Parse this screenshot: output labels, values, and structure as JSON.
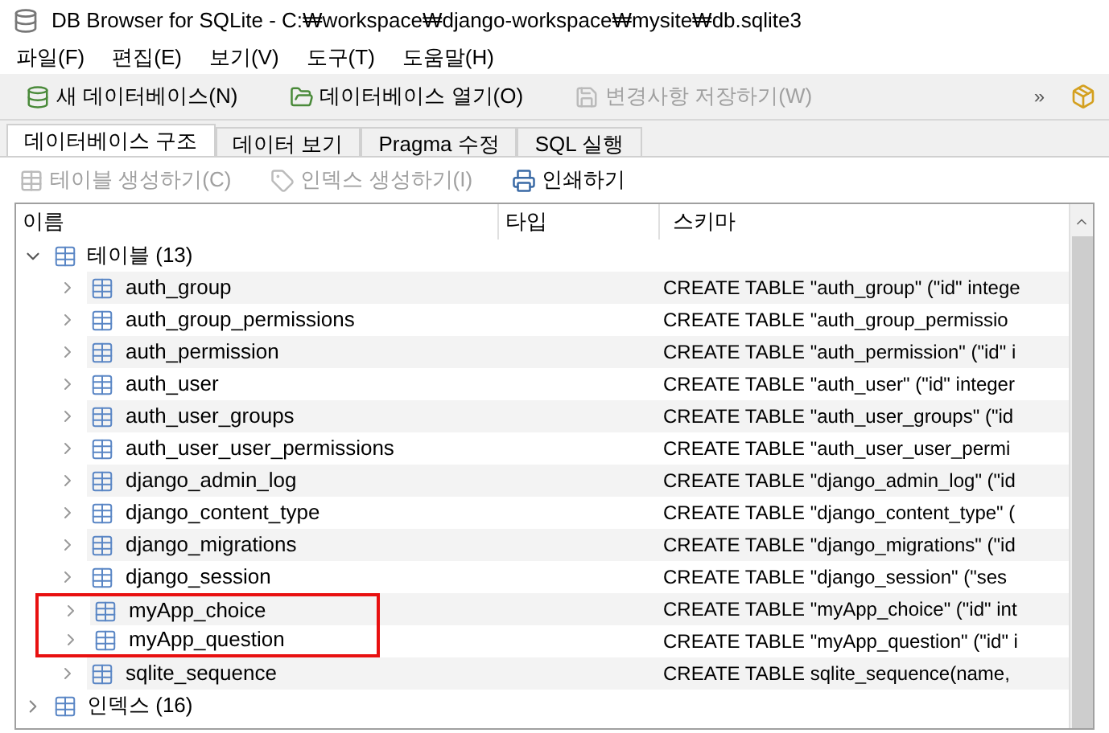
{
  "window": {
    "title": "DB Browser for SQLite - C:₩workspace₩django-workspace₩mysite₩db.sqlite3"
  },
  "menu": [
    "파일(F)",
    "편집(E)",
    "보기(V)",
    "도구(T)",
    "도움말(H)"
  ],
  "toolbar": [
    {
      "label": "새 데이터베이스(N)",
      "disabled": false,
      "kind": "new"
    },
    {
      "label": "데이터베이스 열기(O)",
      "disabled": false,
      "kind": "open"
    },
    {
      "label": "변경사항 저장하기(W)",
      "disabled": true,
      "kind": "save"
    }
  ],
  "toolbar_overflow": "»",
  "tabs": [
    {
      "label": "데이터베이스 구조",
      "selected": true
    },
    {
      "label": "데이터 보기",
      "selected": false
    },
    {
      "label": "Pragma 수정",
      "selected": false
    },
    {
      "label": "SQL 실행",
      "selected": false
    }
  ],
  "actions": [
    {
      "label": "테이블 생성하기(C)",
      "disabled": true,
      "kind": "table"
    },
    {
      "label": "인덱스 생성하기(I)",
      "disabled": true,
      "kind": "index"
    },
    {
      "label": "인쇄하기",
      "disabled": false,
      "kind": "print"
    }
  ],
  "tree": {
    "columns": [
      "이름",
      "타입",
      "스키마"
    ],
    "groups": [
      {
        "label": "테이블 (13)",
        "expanded": true,
        "children": [
          {
            "name": "auth_group",
            "schema": "CREATE TABLE \"auth_group\" (\"id\" intege",
            "highlighted": false
          },
          {
            "name": "auth_group_permissions",
            "schema": "CREATE TABLE \"auth_group_permissio",
            "highlighted": false
          },
          {
            "name": "auth_permission",
            "schema": "CREATE TABLE \"auth_permission\" (\"id\" i",
            "highlighted": false
          },
          {
            "name": "auth_user",
            "schema": "CREATE TABLE \"auth_user\" (\"id\" integer",
            "highlighted": false
          },
          {
            "name": "auth_user_groups",
            "schema": "CREATE TABLE \"auth_user_groups\" (\"id",
            "highlighted": false
          },
          {
            "name": "auth_user_user_permissions",
            "schema": "CREATE TABLE \"auth_user_user_permi",
            "highlighted": false
          },
          {
            "name": "django_admin_log",
            "schema": "CREATE TABLE \"django_admin_log\" (\"id",
            "highlighted": false
          },
          {
            "name": "django_content_type",
            "schema": "CREATE TABLE \"django_content_type\" (",
            "highlighted": false
          },
          {
            "name": "django_migrations",
            "schema": "CREATE TABLE \"django_migrations\" (\"id",
            "highlighted": false
          },
          {
            "name": "django_session",
            "schema": "CREATE TABLE \"django_session\" (\"ses",
            "highlighted": false
          },
          {
            "name": "myApp_choice",
            "schema": "CREATE TABLE \"myApp_choice\" (\"id\" int",
            "highlighted": true
          },
          {
            "name": "myApp_question",
            "schema": "CREATE TABLE \"myApp_question\" (\"id\" i",
            "highlighted": true
          },
          {
            "name": "sqlite_sequence",
            "schema": "CREATE TABLE sqlite_sequence(name,",
            "highlighted": false
          }
        ]
      },
      {
        "label": "인덱스 (16)",
        "expanded": false
      }
    ]
  }
}
